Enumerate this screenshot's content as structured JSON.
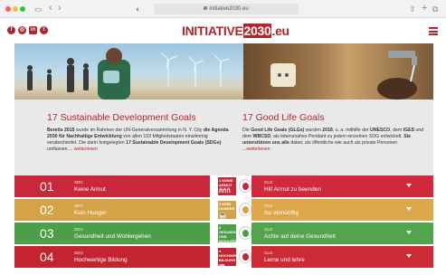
{
  "browser": {
    "url": "initiative2030.eu",
    "back_glyph": "‹",
    "forward_glyph": "›",
    "sidebar_glyph": "▭",
    "shield_glyph": "◐",
    "share_glyph": "⇧",
    "newtab_glyph": "+",
    "tabs_glyph": "⧉"
  },
  "header": {
    "logo_prefix": "INITIATIVE",
    "logo_number": "2030",
    "logo_suffix": ".eu",
    "social": [
      "f",
      "◎",
      "in",
      "t"
    ]
  },
  "intro": {
    "sdg": {
      "title": "17 Sustainable Development Goals",
      "p1_b1": "Bereits 2015",
      "p1_t1": " wurde im Rahmen der UN-Generalversammlung in N. Y. City ",
      "p1_b2": "die Agenda",
      "p2_b1": "2030 für Nachhaltige Entwicklung",
      "p2_t1": " von allen 193 Mitgliedstaaten einstimmig",
      "p3_t1": "verabschiedet. Die darin festgelegten ",
      "p3_b1": "17 Sustainable Development Goals (SDGs)",
      "p4_t1": "umfassen ... ",
      "more": "weiterlesen"
    },
    "glg": {
      "title": "17 Good Life Goals",
      "p1_t1": "Die ",
      "p1_b1": "Good Life Goals (GLGs)",
      "p1_t2": " wurden ",
      "p1_b2": "2018",
      "p1_t3": ", u. a. mithilfe der ",
      "p1_b3": "UNESCO",
      "p1_t4": ", dem ",
      "p1_b4": "IGES",
      "p1_t5": " und",
      "p2_t1": "dem ",
      "p2_b1": "WBCSD",
      "p2_t2": ", als lebensnahes Pendant zu jedem einzelnen SDG entwickelt. ",
      "p2_b2": "Sie",
      "p3_b1": "unterstützen uns alle",
      "p3_t1": " dabei, als öffentliche wie auch als private Personen",
      "p4_t1": "...",
      "more": "weiterlesen"
    }
  },
  "goals": [
    {
      "num": "01",
      "sdg_tag": "SDG",
      "sdg_label": "Keine Armut",
      "icon_text": "1 KEINE ARMUT",
      "icon_glyph": "ñññ",
      "glg_tag": "GLG",
      "glg_label": "Hilf Armut zu beenden",
      "color": "#c8283a",
      "color_right": "#d02a3c"
    },
    {
      "num": "02",
      "sdg_tag": "SDG",
      "sdg_label": "Kein Hunger",
      "icon_text": "2 KEIN HUNGER",
      "icon_glyph": "☕",
      "glg_tag": "GLG",
      "glg_label": "Iss vernünftig",
      "color": "#d4a348",
      "color_right": "#dca84a"
    },
    {
      "num": "03",
      "sdg_tag": "SDG",
      "sdg_label": "Gesundheit und Wohlergehen",
      "icon_text": "3 GESUNDHEIT UND WOHLERGEHEN",
      "icon_glyph": "~♥",
      "glg_tag": "GLG",
      "glg_label": "Achte auf deine Gesundheit",
      "color": "#4c9e48",
      "color_right": "#52a54c"
    },
    {
      "num": "04",
      "sdg_tag": "SDG",
      "sdg_label": "Hochwertige Bildung",
      "icon_text": "4 HOCHWERTIGE BILDUNG",
      "icon_glyph": "▥",
      "glg_tag": "GLG",
      "glg_label": "Lerne und lehre",
      "color": "#c3242f",
      "color_right": "#cc2a34"
    }
  ]
}
